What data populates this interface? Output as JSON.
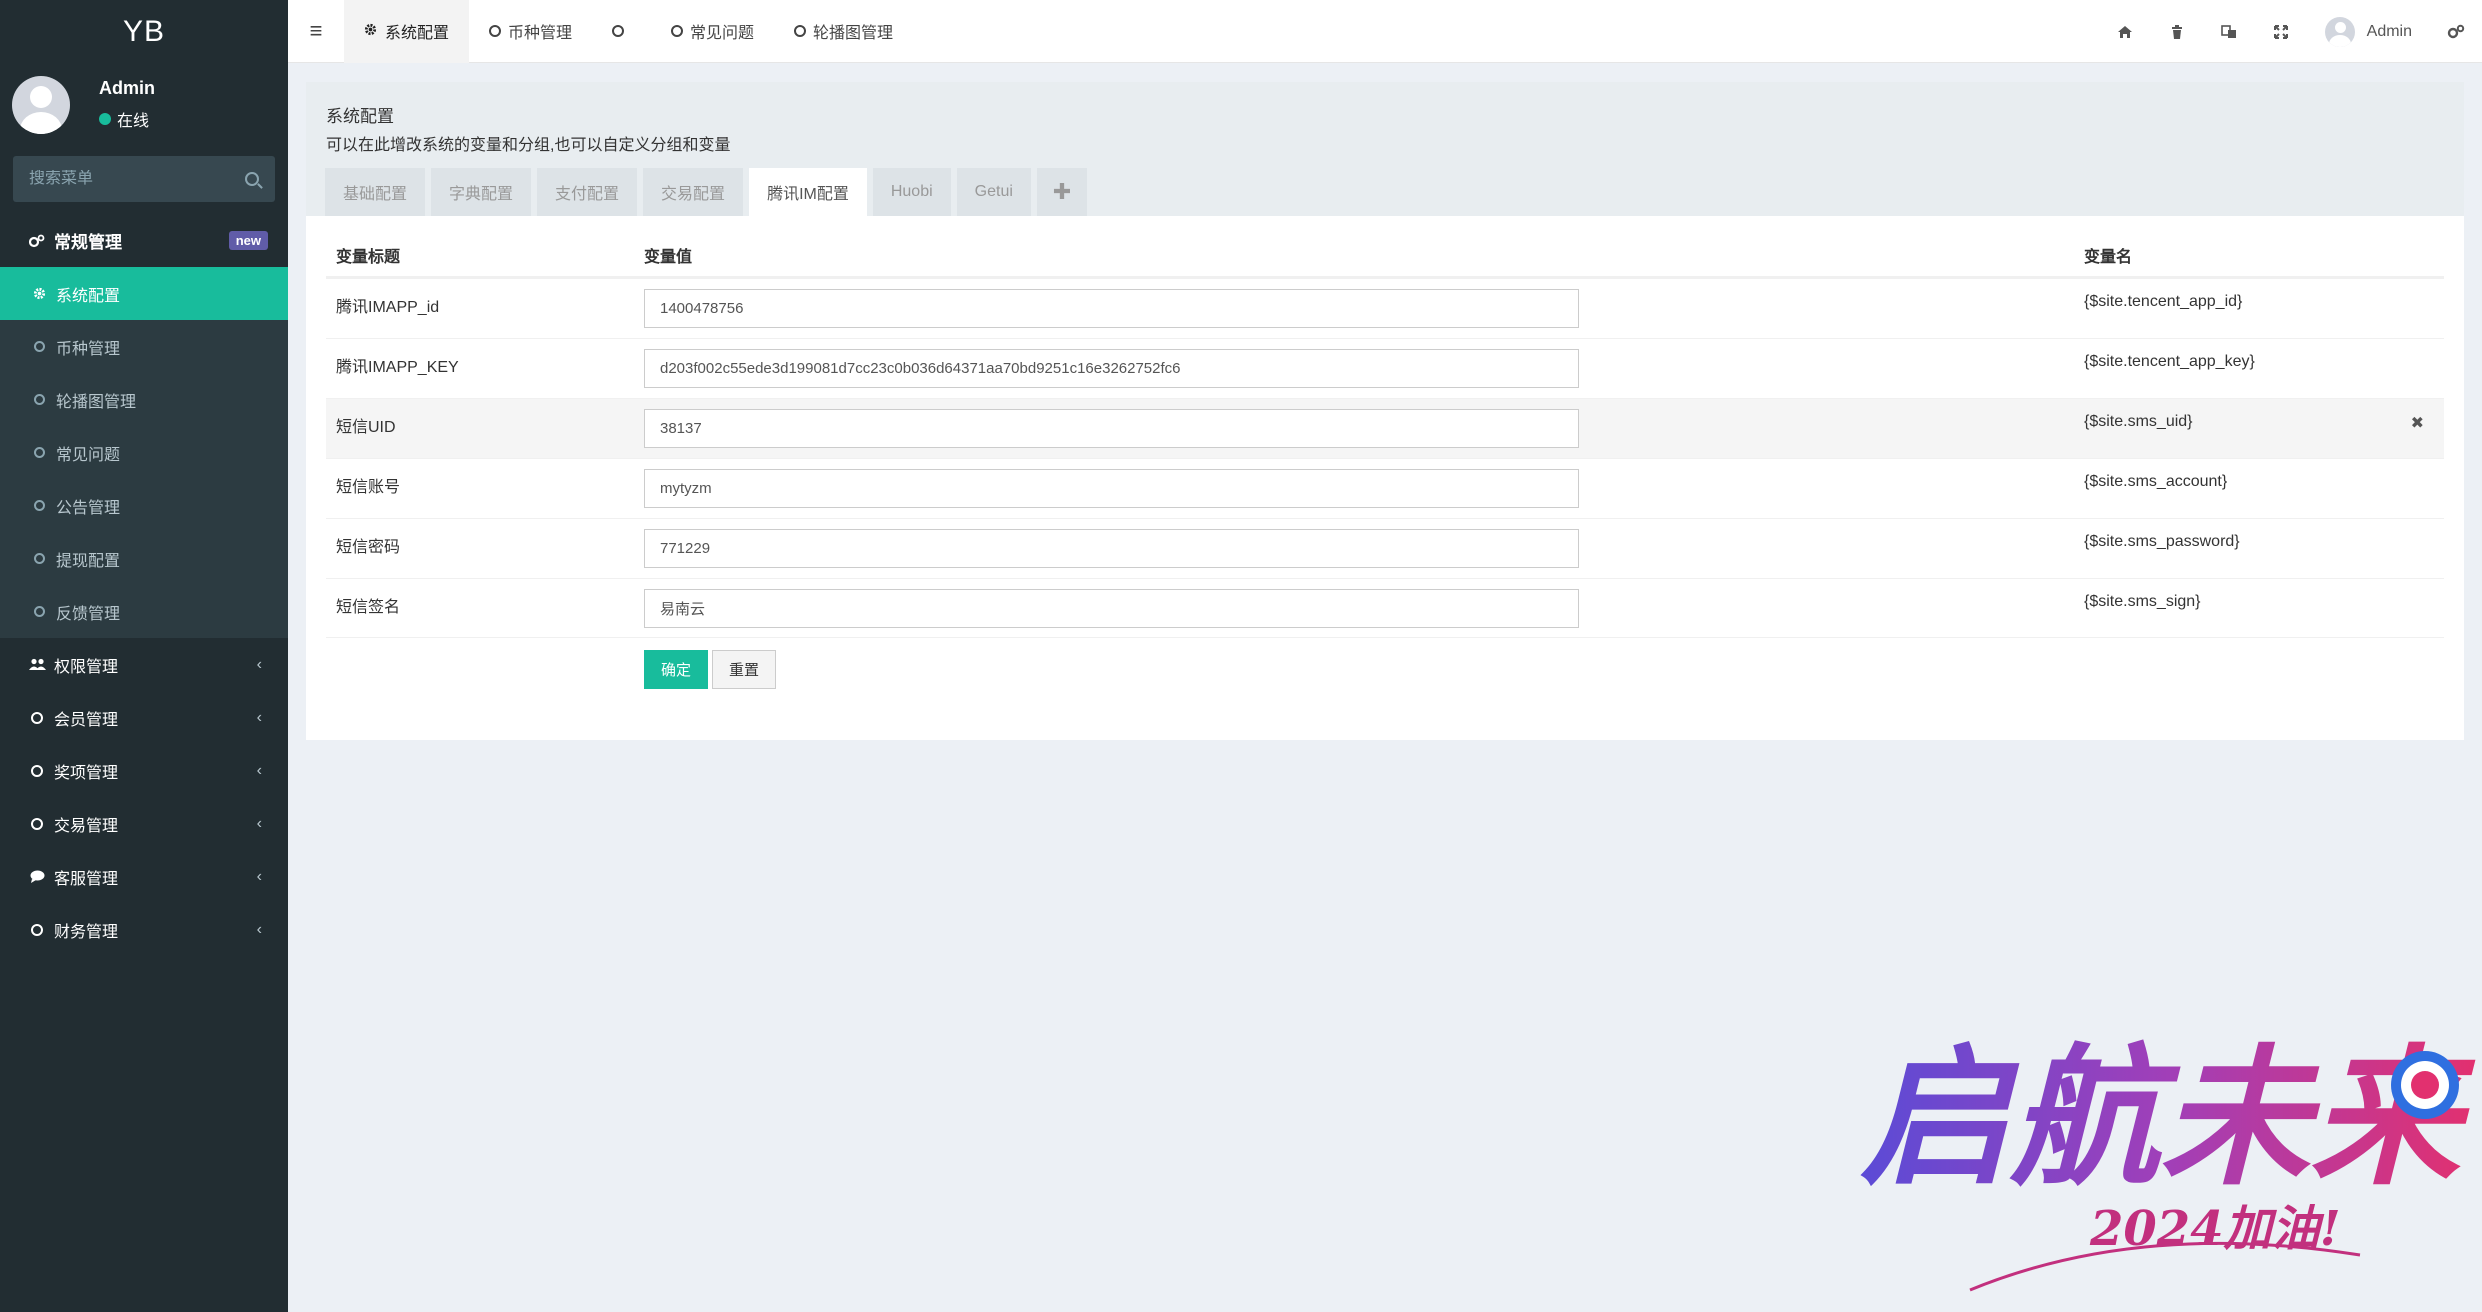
{
  "brand": "YB",
  "user": {
    "name": "Admin",
    "status": "在线"
  },
  "search": {
    "placeholder": "搜索菜单"
  },
  "sidebar": {
    "general": {
      "label": "常规管理",
      "badge": "new"
    },
    "sub_items": [
      "系统配置",
      "币种管理",
      "轮播图管理",
      "常见问题",
      "公告管理",
      "提现配置",
      "反馈管理"
    ],
    "groups": [
      "权限管理",
      "会员管理",
      "奖项管理",
      "交易管理",
      "客服管理",
      "财务管理"
    ]
  },
  "topnav": {
    "tabs": [
      "系统配置",
      "币种管理",
      "",
      "常见问题",
      "轮播图管理"
    ],
    "user": "Admin"
  },
  "panel": {
    "title": "系统配置",
    "desc": "可以在此增改系统的变量和分组,也可以自定义分组和变量",
    "tabs": [
      "基础配置",
      "字典配置",
      "支付配置",
      "交易配置",
      "腾讯IM配置",
      "Huobi",
      "Getui"
    ],
    "active_tab": "腾讯IM配置"
  },
  "table": {
    "headers": {
      "title": "变量标题",
      "value": "变量值",
      "name": "变量名"
    },
    "rows": [
      {
        "title": "腾讯IMAPP_id",
        "value": "1400478756",
        "name": "{$site.tencent_app_id}"
      },
      {
        "title": "腾讯IMAPP_KEY",
        "value": "d203f002c55ede3d199081d7cc23c0b036d64371aa70bd9251c16e3262752fc6",
        "name": "{$site.tencent_app_key}"
      },
      {
        "title": "短信UID",
        "value": "38137",
        "name": "{$site.sms_uid}"
      },
      {
        "title": "短信账号",
        "value": "mytyzm",
        "name": "{$site.sms_account}"
      },
      {
        "title": "短信密码",
        "value": "771229",
        "name": "{$site.sms_password}"
      },
      {
        "title": "短信签名",
        "value": "易南云",
        "name": "{$site.sms_sign}"
      }
    ]
  },
  "buttons": {
    "ok": "确定",
    "reset": "重置"
  },
  "watermark": {
    "main": "启航未来",
    "sub": "2024加油!"
  },
  "colors": {
    "accent": "#18bc9c",
    "sidebar": "#222d32",
    "badge": "#605ca8"
  }
}
